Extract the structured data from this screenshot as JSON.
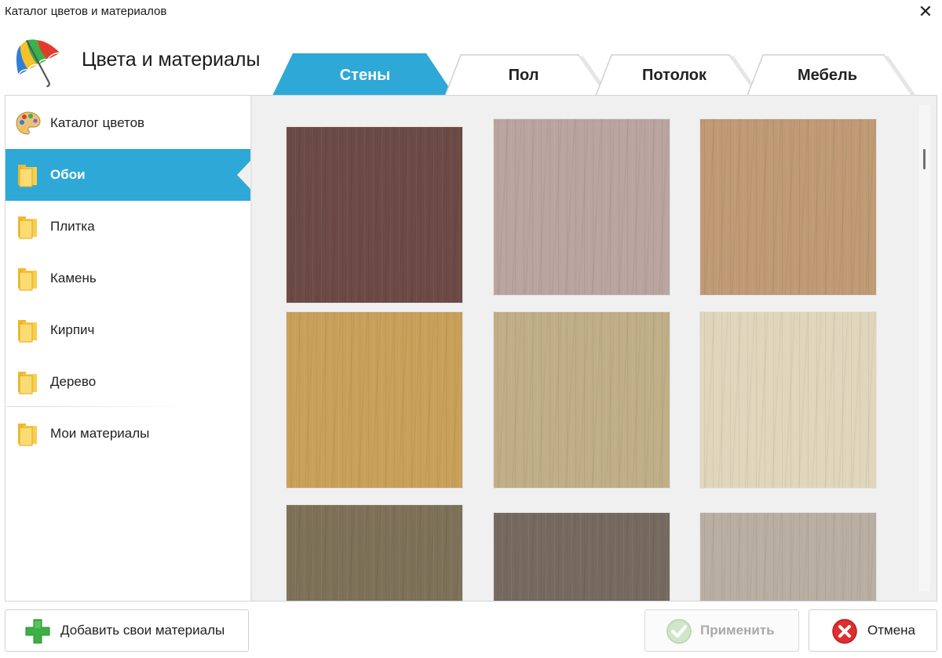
{
  "window": {
    "title": "Каталог цветов и материалов",
    "close_glyph": "✕"
  },
  "header": {
    "title": "Цвета и материалы",
    "logo_icon": "umbrella-icon"
  },
  "tabs": [
    {
      "label": "Стены",
      "active": true
    },
    {
      "label": "Пол",
      "active": false
    },
    {
      "label": "Потолок",
      "active": false
    },
    {
      "label": "Мебель",
      "active": false
    }
  ],
  "sidebar": {
    "items": [
      {
        "label": "Каталог цветов",
        "icon": "palette-icon",
        "active": false
      },
      {
        "label": "Обои",
        "icon": "folder-icon",
        "active": true
      },
      {
        "label": "Плитка",
        "icon": "folder-icon",
        "active": false
      },
      {
        "label": "Камень",
        "icon": "folder-icon",
        "active": false
      },
      {
        "label": "Кирпич",
        "icon": "folder-icon",
        "active": false
      },
      {
        "label": "Дерево",
        "icon": "folder-icon",
        "active": false
      },
      {
        "label": "Мои материалы",
        "icon": "folder-icon",
        "active": false
      }
    ]
  },
  "swatches": [
    {
      "color": "#6c4a45"
    },
    {
      "color": "#b9a49f"
    },
    {
      "color": "#bf9a75"
    },
    {
      "color": "#c8a05a"
    },
    {
      "color": "#bfae88"
    },
    {
      "color": "#e0d6bc"
    },
    {
      "color": "#7d7258"
    },
    {
      "color": "#766a60"
    },
    {
      "color": "#b9aea2"
    }
  ],
  "buttons": {
    "add": {
      "label": "Добавить свои материалы",
      "icon": "plus-icon"
    },
    "apply": {
      "label": "Применить",
      "icon": "checkmark-icon",
      "disabled": true
    },
    "cancel": {
      "label": "Отмена",
      "icon": "cancel-icon"
    }
  },
  "colors": {
    "accent": "#2ea8d6",
    "content_bg": "#f0f0f0"
  }
}
